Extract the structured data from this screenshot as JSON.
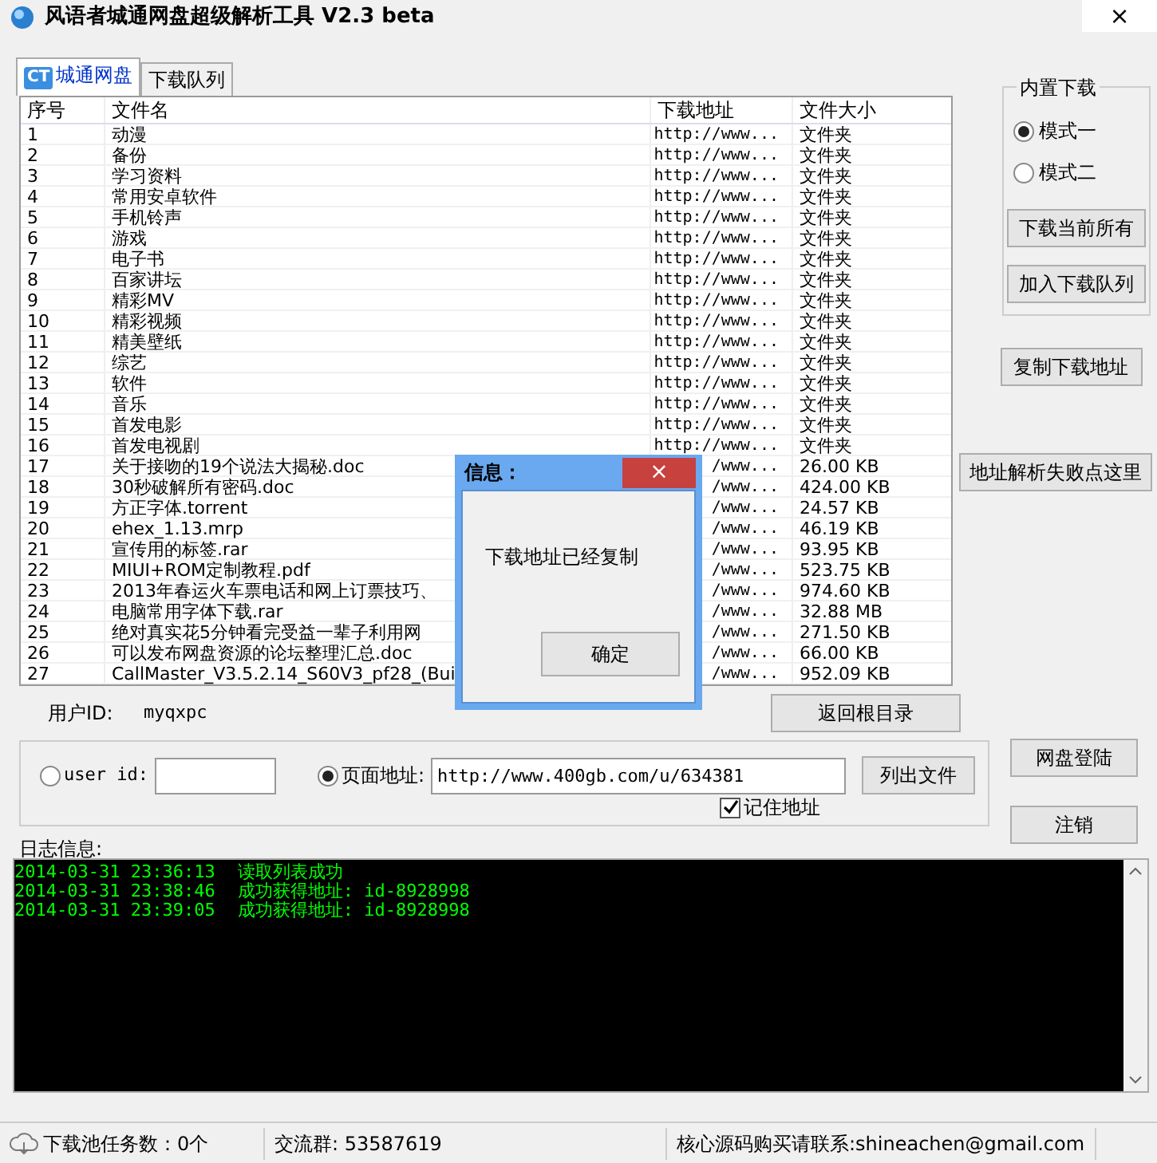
{
  "window": {
    "title": "风语者城通网盘超级解析工具 V2.3 beta",
    "close": "×"
  },
  "tabs": [
    {
      "label": "城通网盘",
      "icon": "CT",
      "selected": true
    },
    {
      "label": "下载队列",
      "selected": false
    }
  ],
  "table": {
    "columns": [
      "序号",
      "文件名",
      "下载地址",
      "文件大小"
    ],
    "rows": [
      [
        "1",
        "动漫",
        "http://www...",
        "文件夹"
      ],
      [
        "2",
        "备份",
        "http://www...",
        "文件夹"
      ],
      [
        "3",
        "学习资料",
        "http://www...",
        "文件夹"
      ],
      [
        "4",
        "常用安卓软件",
        "http://www...",
        "文件夹"
      ],
      [
        "5",
        "手机铃声",
        "http://www...",
        "文件夹"
      ],
      [
        "6",
        "游戏",
        "http://www...",
        "文件夹"
      ],
      [
        "7",
        "电子书",
        "http://www...",
        "文件夹"
      ],
      [
        "8",
        "百家讲坛",
        "http://www...",
        "文件夹"
      ],
      [
        "9",
        "精彩MV",
        "http://www...",
        "文件夹"
      ],
      [
        "10",
        "精彩视频",
        "http://www...",
        "文件夹"
      ],
      [
        "11",
        "精美壁纸",
        "http://www...",
        "文件夹"
      ],
      [
        "12",
        "综艺",
        "http://www...",
        "文件夹"
      ],
      [
        "13",
        "软件",
        "http://www...",
        "文件夹"
      ],
      [
        "14",
        "音乐",
        "http://www...",
        "文件夹"
      ],
      [
        "15",
        "首发电影",
        "http://www...",
        "文件夹"
      ],
      [
        "16",
        "首发电视剧",
        "http://www...",
        "文件夹"
      ],
      [
        "17",
        "关于接吻的19个说法大揭秘.doc",
        "/www...",
        "26.00 KB"
      ],
      [
        "18",
        "30秒破解所有密码.doc",
        "/www...",
        "424.00 KB"
      ],
      [
        "19",
        "方正字体.torrent",
        "/www...",
        "24.57 KB"
      ],
      [
        "20",
        "ehex_1.13.mrp",
        "/www...",
        "46.19 KB"
      ],
      [
        "21",
        "宣传用的标签.rar",
        "/www...",
        "93.95 KB"
      ],
      [
        "22",
        "MIUI+ROM定制教程.pdf",
        "/www...",
        "523.75 KB"
      ],
      [
        "23",
        "2013年春运火车票电话和网上订票技巧、",
        "/www...",
        "974.60 KB"
      ],
      [
        "24",
        "电脑常用字体下载.rar",
        "/www...",
        "32.88 MB"
      ],
      [
        "25",
        "绝对真实花5分钟看完受益一辈子利用网",
        "/www...",
        "271.50 KB"
      ],
      [
        "26",
        "可以发布网盘资源的论坛整理汇总.doc",
        "/www...",
        "66.00 KB"
      ],
      [
        "27",
        "CallMaster_V3.5.2.14_S60V3_pf28_(Bui",
        "/www...",
        "952.09 KB"
      ]
    ]
  },
  "builtin_download": {
    "title": "内置下载",
    "modes": [
      {
        "label": "模式一",
        "selected": true
      },
      {
        "label": "模式二",
        "selected": false
      }
    ],
    "buttons": [
      "下载当前所有",
      "加入下载队列"
    ]
  },
  "copy_button": "复制下载地址",
  "fail_button": "地址解析失败点这里",
  "user_id": {
    "label": "用户ID:",
    "value": "myqxpc"
  },
  "root_button": "返回根目录",
  "source": {
    "options": [
      {
        "label": "user id:",
        "selected": false
      },
      {
        "label": "页面地址:",
        "selected": true,
        "value": "http://www.400gb.com/u/634381"
      }
    ],
    "list_button": "列出文件",
    "remember": {
      "label": "记住地址",
      "checked": true
    }
  },
  "login_button": "网盘登陆",
  "logout_button": "注销",
  "log": {
    "label": "日志信息:",
    "lines": [
      {
        "time": "2014-03-31 23:36:13",
        "message": "读取列表成功"
      },
      {
        "time": "2014-03-31 23:38:46",
        "message": "成功获得地址: id-8928998"
      },
      {
        "time": "2014-03-31 23:39:05",
        "message": "成功获得地址: id-8928998"
      }
    ]
  },
  "status_bar": [
    "下载池任务数：0个",
    "交流群: 53587619",
    "核心源码购买请联系:shineachen@gmail.com"
  ],
  "dialog": {
    "title": "信息：",
    "close": "×",
    "message": "下载地址已经复制",
    "button": "确定"
  }
}
